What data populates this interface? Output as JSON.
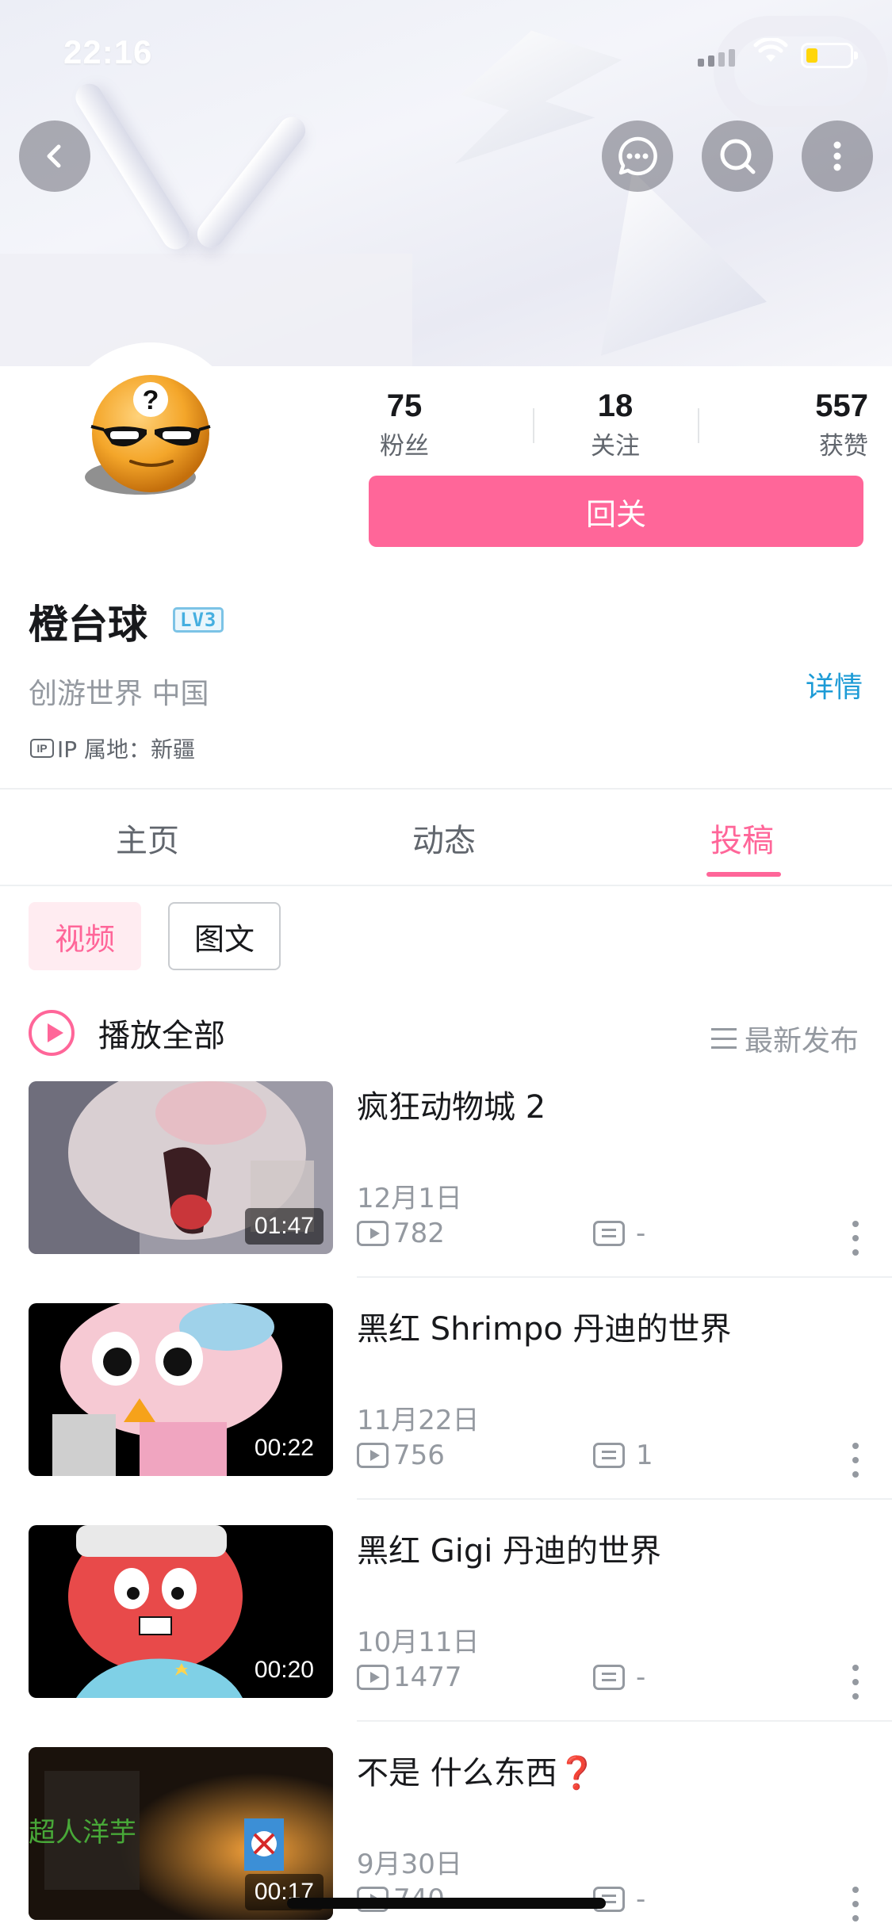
{
  "status_bar": {
    "time": "22:16"
  },
  "header": {
    "icons": [
      "back-icon",
      "message-icon",
      "search-icon",
      "more-icon"
    ]
  },
  "profile": {
    "stats": [
      {
        "value": "75",
        "label": "粉丝"
      },
      {
        "value": "18",
        "label": "关注"
      },
      {
        "value": "557",
        "label": "获赞"
      }
    ],
    "follow_button": "回关",
    "name": "橙台球",
    "level": "LV3",
    "signature": "创游世界 中国",
    "details_link": "详情",
    "ip_badge": "IP",
    "ip_location": "IP 属地：新疆"
  },
  "tabs": [
    {
      "label": "主页",
      "active": false
    },
    {
      "label": "动态",
      "active": false
    },
    {
      "label": "投稿",
      "active": true
    }
  ],
  "filters": [
    {
      "label": "视频",
      "active": true
    },
    {
      "label": "图文",
      "active": false
    }
  ],
  "list_header": {
    "play_all": "播放全部",
    "sort": "最新发布"
  },
  "videos": [
    {
      "title": "疯狂动物城 2",
      "duration": "01:47",
      "date": "12月1日",
      "plays": "782",
      "comments": "-"
    },
    {
      "title": "黑红 Shrimpo 丹迪的世界",
      "duration": "00:22",
      "date": "11月22日",
      "plays": "756",
      "comments": "1"
    },
    {
      "title": "黑红 Gigi 丹迪的世界",
      "duration": "00:20",
      "date": "10月11日",
      "plays": "1477",
      "comments": "-"
    },
    {
      "title": "不是 什么东西❓",
      "duration": "00:17",
      "date": "9月30日",
      "plays": "740",
      "comments": "-",
      "thumb_text": "超人洋芋"
    }
  ],
  "colors": {
    "accent": "#ff6699",
    "link": "#1c9bd6",
    "muted": "#9499a0"
  }
}
